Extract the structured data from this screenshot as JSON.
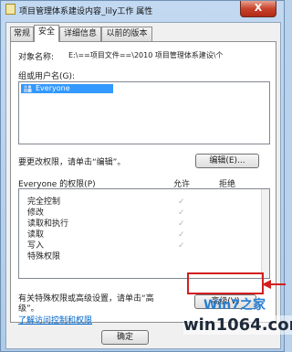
{
  "window": {
    "title": "项目管理体系建设内容_lily工作 属性",
    "close_glyph": "X",
    "close_color": "#c8432c"
  },
  "tabs": [
    {
      "label": "常规"
    },
    {
      "label": "安全",
      "selected": true
    },
    {
      "label": "详细信息"
    },
    {
      "label": "以前的版本"
    }
  ],
  "security": {
    "object_name_label": "对象名称:",
    "object_name_value": "E:\\==项目文件==\\2010 项目管理体系建设\\个",
    "groups_label": "组或用户名(G):",
    "groups": [
      "Everyone"
    ],
    "edit_hint": "要更改权限，请单击“编辑”。",
    "edit_button": "编辑(E)...",
    "perm_header": "Everyone 的权限(P)",
    "allow_header": "允许",
    "deny_header": "拒绝",
    "permissions": [
      {
        "name": "完全控制",
        "allow": true,
        "deny": false
      },
      {
        "name": "修改",
        "allow": true,
        "deny": false
      },
      {
        "name": "读取和执行",
        "allow": true,
        "deny": false
      },
      {
        "name": "读取",
        "allow": true,
        "deny": false
      },
      {
        "name": "写入",
        "allow": true,
        "deny": false
      },
      {
        "name": "特殊权限",
        "allow": false,
        "deny": false
      }
    ],
    "check_glyph": "✓",
    "special_hint_line1": "有关特殊权限或高级设置，请单击“高",
    "special_hint_line2": "级”。",
    "advanced_button": "高级(V)",
    "access_link": "了解访问控制和权限",
    "highlight_color": "#d21f1f"
  },
  "footer": {
    "ok_button": "确定"
  },
  "watermark": {
    "line1": "Win7之家",
    "line2": "win1064.com"
  }
}
